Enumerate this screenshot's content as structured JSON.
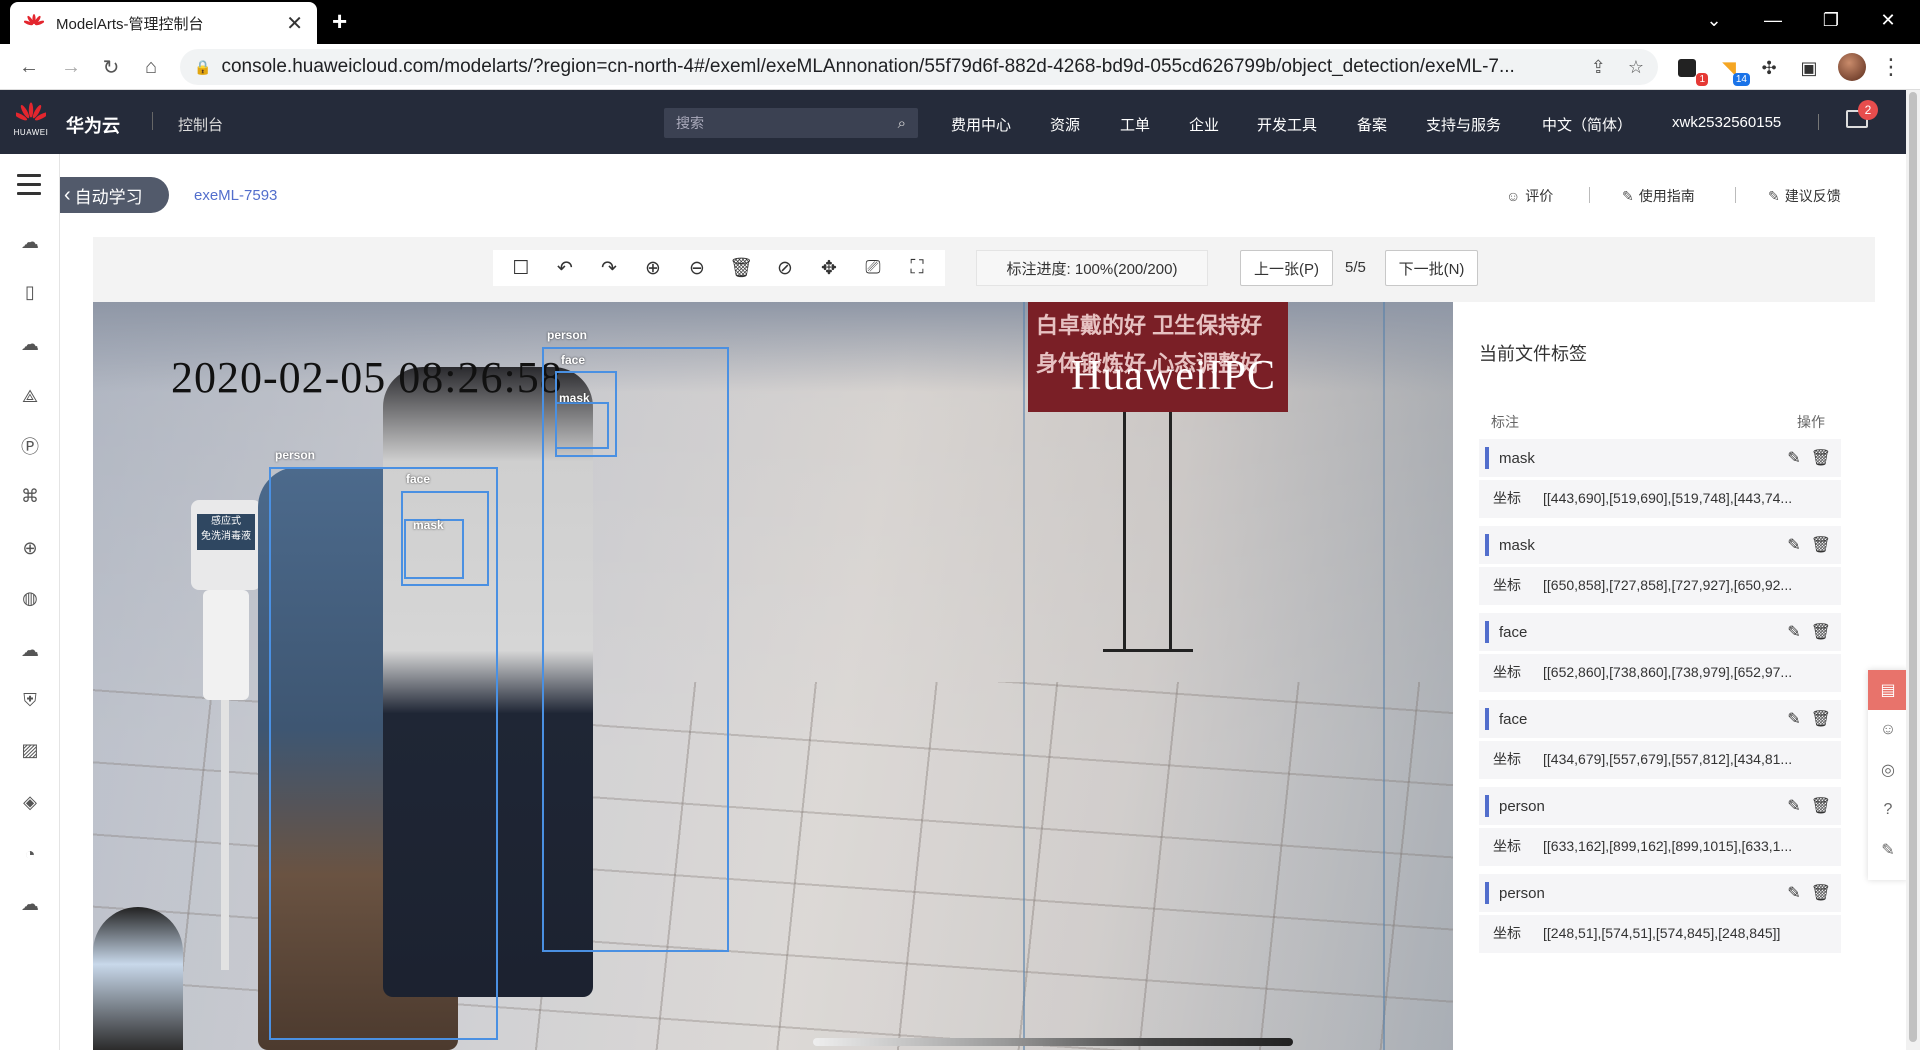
{
  "browser": {
    "tab_title": "ModelArts-管理控制台",
    "tab_close": "✕",
    "new_tab": "+",
    "url": "console.huaweicloud.com/modelarts/?region=cn-north-4#/exeml/exeMLAnnonation/55f79d6f-882d-4268-bd9d-055cd626799b/object_detection/exeML-7...",
    "ext_badges": {
      "first": "1",
      "second": "14"
    },
    "colors": {
      "badge_red": "#e53935",
      "badge_blue": "#1a73e8"
    }
  },
  "header": {
    "logo_text": "HUAWEI",
    "brand": "华为云",
    "console": "控制台",
    "search_placeholder": "搜索",
    "nav": [
      "费用中心",
      "资源",
      "工单",
      "企业",
      "开发工具",
      "备案",
      "支持与服务",
      "中文（简体）",
      "xwk2532560155"
    ],
    "mail_badge": "2"
  },
  "breadcrumb": {
    "back_label": "自动学习",
    "project": "exeML-7593",
    "links": {
      "rate": "评价",
      "guide": "使用指南",
      "feedback": "建议反馈"
    }
  },
  "toolbar": {
    "progress_text": "标注进度: 100%(200/200)",
    "prev_label": "上一张(P)",
    "page_count": "5/5",
    "next_label": "下一批(N)"
  },
  "canvas": {
    "timestamp": "2020-02-05 08:26:58",
    "banner_lines": [
      "白卓戴的好 卫生保持好",
      "身体锻炼好 心态调整好"
    ],
    "ipc_text": "HuaweiIPC",
    "stand_sign": "感应式\n免洗消毒液",
    "boxes": [
      {
        "label": "person",
        "name": "bbox-person-2"
      },
      {
        "label": "face",
        "name": "bbox-face-2"
      },
      {
        "label": "mask",
        "name": "bbox-mask-2"
      },
      {
        "label": "person",
        "name": "bbox-person-1"
      },
      {
        "label": "face",
        "name": "bbox-face-1"
      },
      {
        "label": "mask",
        "name": "bbox-mask-1"
      }
    ],
    "box_color": "#4a90e2"
  },
  "panel": {
    "title": "当前文件标签",
    "col_label": "标注",
    "col_op": "操作",
    "coord_key": "坐标",
    "labels": [
      {
        "name": "mask",
        "coords": "[[443,690],[519,690],[519,748],[443,74..."
      },
      {
        "name": "mask",
        "coords": "[[650,858],[727,858],[727,927],[650,92..."
      },
      {
        "name": "face",
        "coords": "[[652,860],[738,860],[738,979],[652,97..."
      },
      {
        "name": "face",
        "coords": "[[434,679],[557,679],[557,812],[434,81..."
      },
      {
        "name": "person",
        "coords": "[[633,162],[899,162],[899,1015],[633,1..."
      },
      {
        "name": "person",
        "coords": "[[248,51],[574,51],[574,845],[248,845]]"
      }
    ],
    "accent": "#526ecc"
  }
}
